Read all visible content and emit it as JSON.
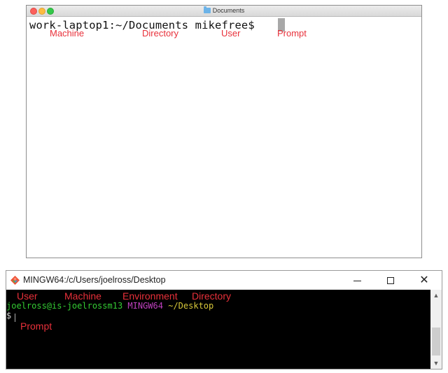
{
  "mac_terminal": {
    "window_title": "Documents",
    "title_icon": "folder-icon",
    "prompt_text": "work-laptop1:~/Documents mikefree$",
    "annotations": {
      "machine": "Machine",
      "directory": "Directory",
      "user": "User",
      "prompt": "Prompt"
    }
  },
  "win_terminal": {
    "window_title": "MINGW64:/c/Users/joelross/Desktop",
    "title_icon": "git-icon",
    "prompt_user_host": "joelross@is-joelrossm13",
    "prompt_env": "MINGW64",
    "prompt_dir": "~/Desktop",
    "prompt_symbol": "$",
    "annotations": {
      "user": "User",
      "machine": "Machine",
      "environment": "Environment",
      "directory": "Directory",
      "prompt": "Prompt"
    }
  },
  "colors": {
    "annotation": "#e8303a",
    "term_green": "#33cc33",
    "term_magenta": "#bf40bf",
    "term_yellow": "#d8c83a",
    "mac_cursor": "#a8a8a8"
  }
}
